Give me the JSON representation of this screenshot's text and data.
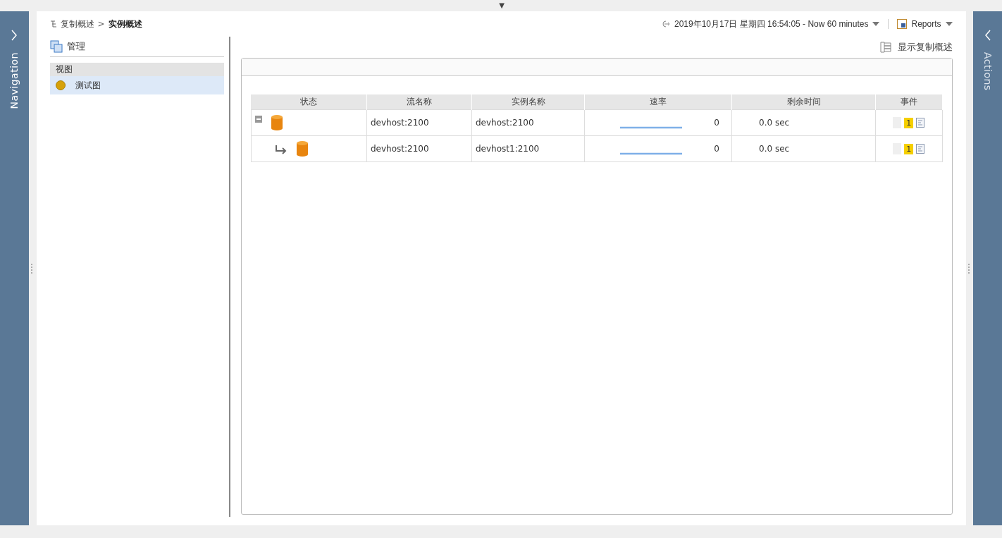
{
  "top_toggle": "▼",
  "navigation_rail": {
    "label": "Navigation"
  },
  "actions_rail": {
    "label": "Actions"
  },
  "breadcrumb": {
    "separator": ">",
    "items": [
      {
        "label": "复制概述",
        "current": false
      },
      {
        "label": "实例概述",
        "current": true
      }
    ]
  },
  "time_range": "2019年10月17日 星期四 16:54:05 - Now 60 minutes",
  "reports": "Reports",
  "sidebar": {
    "title": "管理",
    "section": "视图",
    "items": [
      {
        "label": "测试图",
        "selected": true
      }
    ]
  },
  "show_overview": "显示复制概述",
  "table": {
    "columns": [
      "状态",
      "流名称",
      "实例名称",
      "速率",
      "剩余时间",
      "事件"
    ],
    "rows": [
      {
        "kind": "parent",
        "expanded": true,
        "stream": "devhost:2100",
        "instance": "devhost:2100",
        "rate": "0",
        "remaining": "0.0 sec",
        "events": "1"
      },
      {
        "kind": "child",
        "stream": "devhost:2100",
        "instance": "devhost1:2100",
        "rate": "0",
        "remaining": "0.0 sec",
        "events": "1"
      }
    ]
  }
}
